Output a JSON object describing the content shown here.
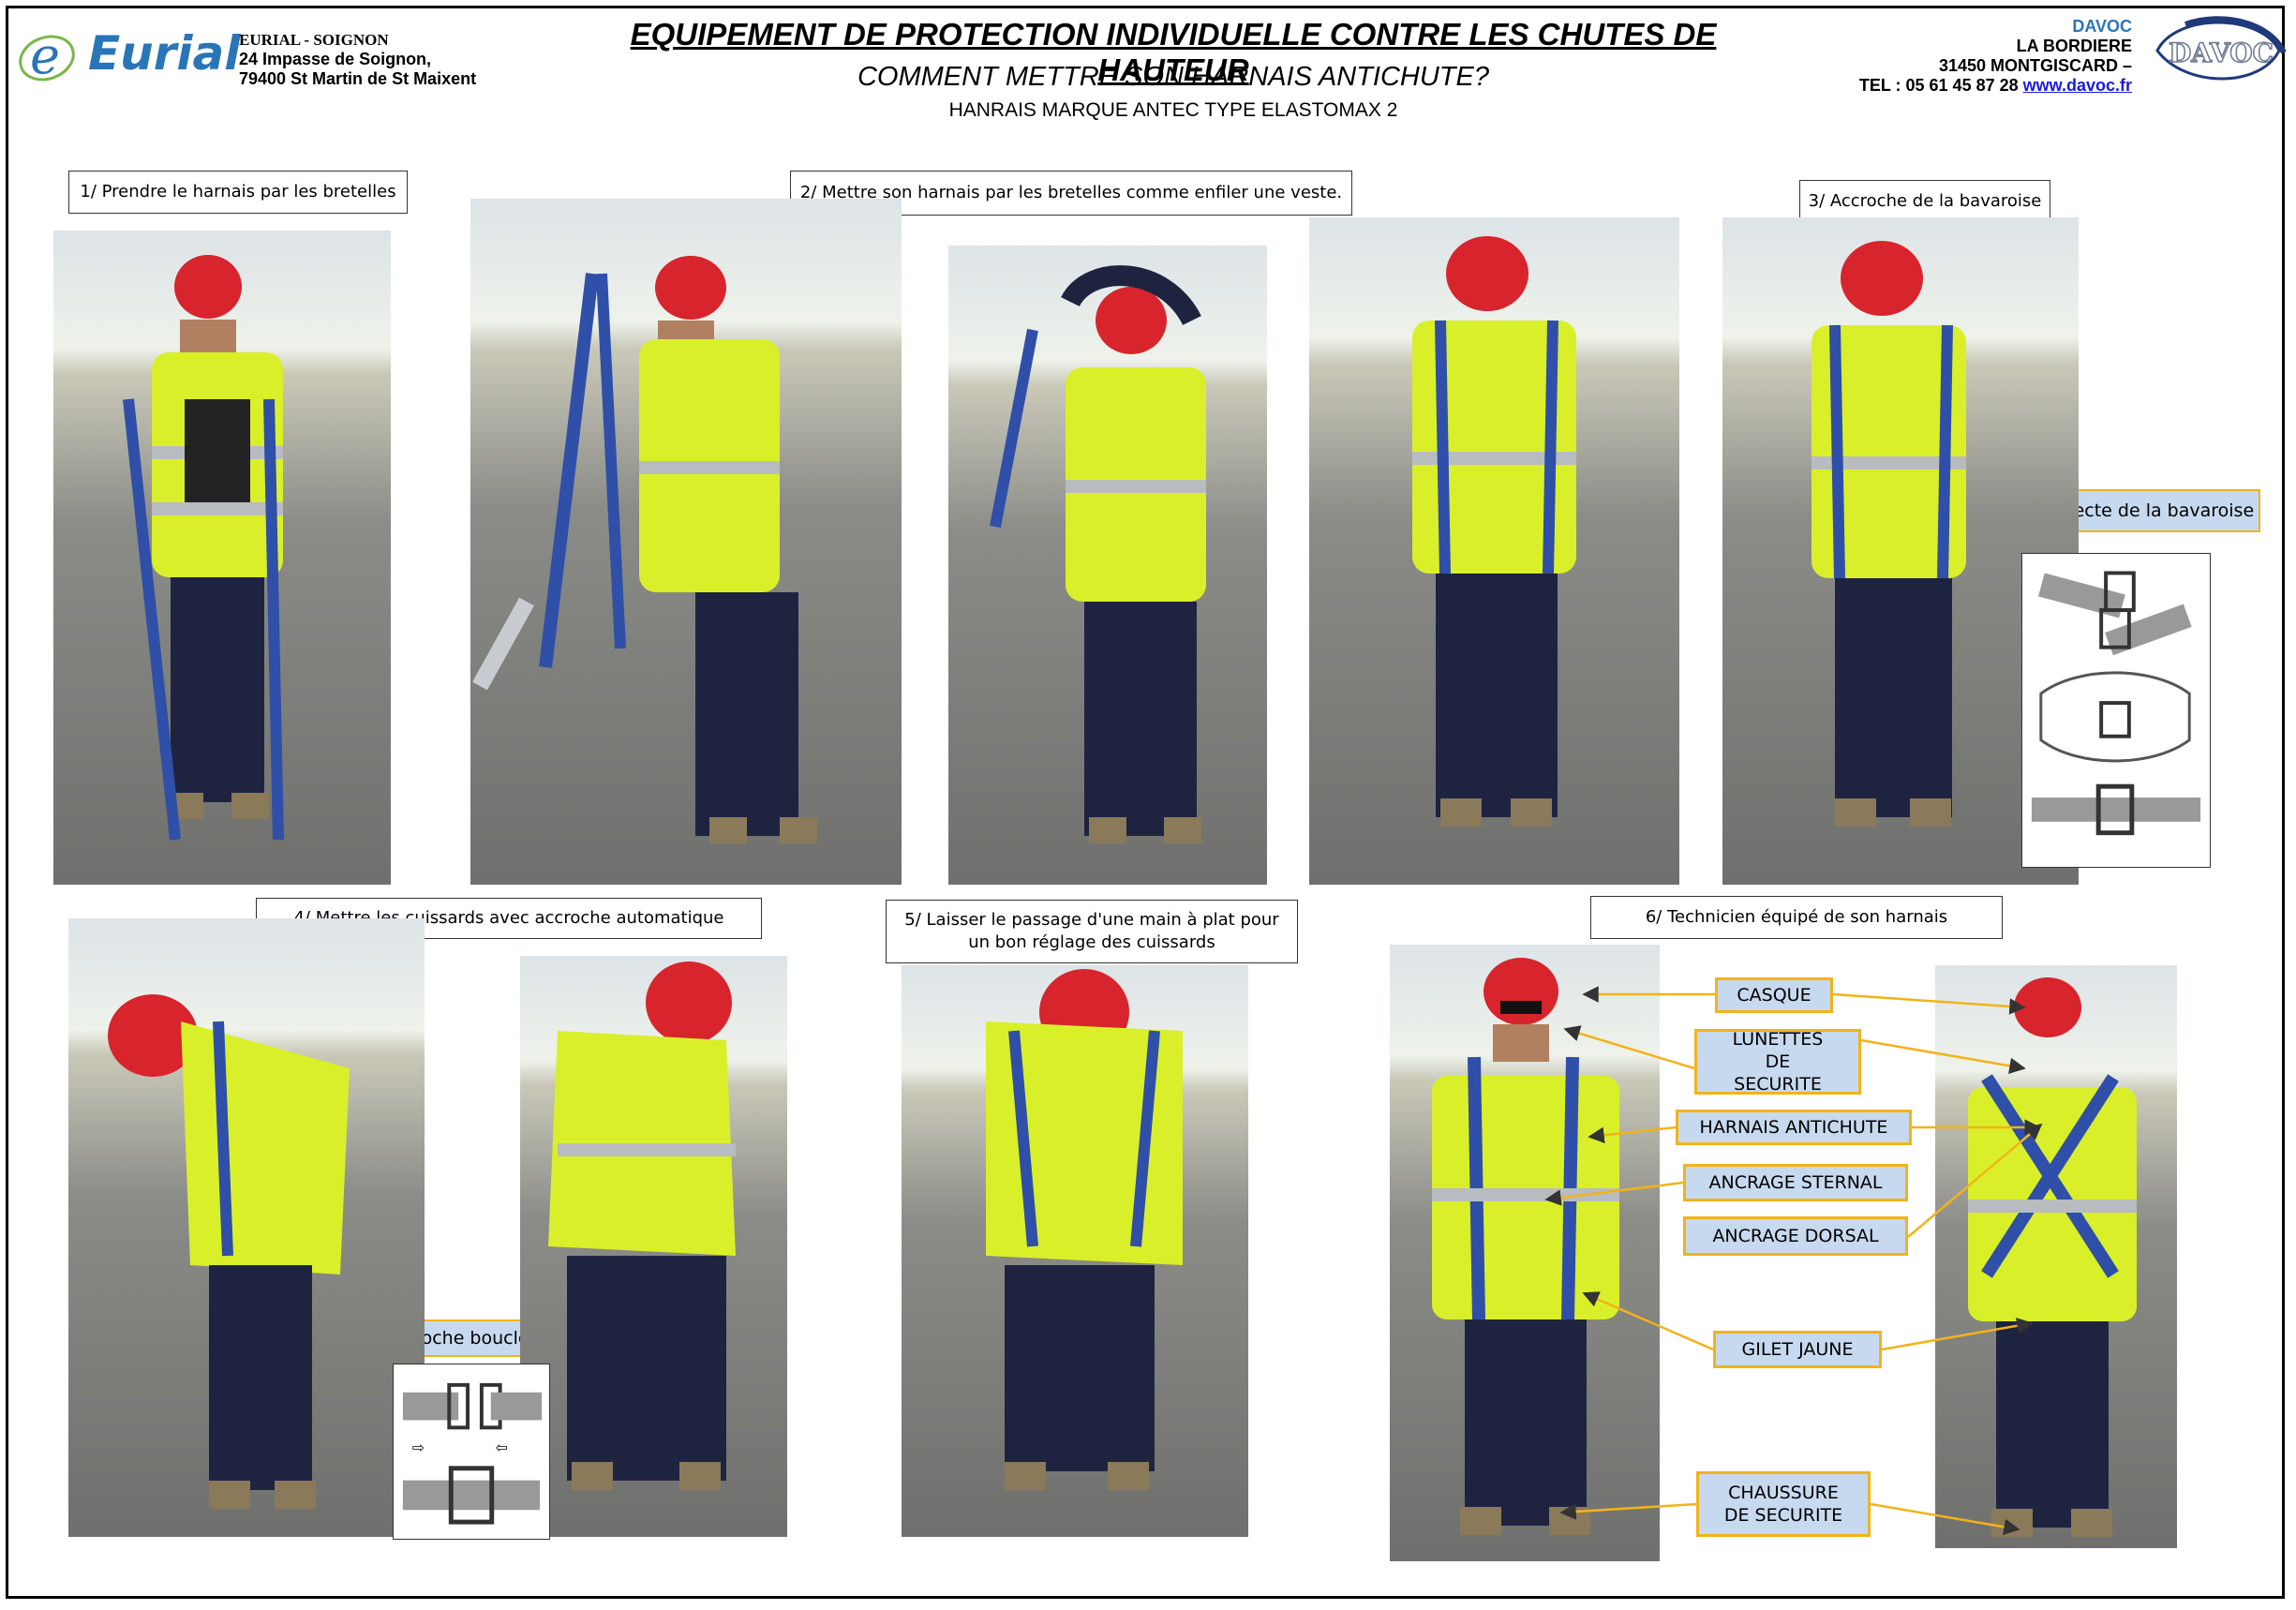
{
  "company": {
    "logo_text": "Eurial",
    "name": "EURIAL - SOIGNON",
    "address1": "24 Impasse de Soignon,",
    "address2": "79400 St Martin de St Maixent"
  },
  "titles": {
    "main": "EQUIPEMENT DE PROTECTION INDIVIDUELLE CONTRE LES CHUTES DE HAUTEUR",
    "sub": "COMMENT METTRE SON HARNAIS ANTICHUTE?",
    "model": "HANRAIS MARQUE ANTEC TYPE ELASTOMAX 2"
  },
  "supplier": {
    "name": "DAVOC",
    "line1": "LA BORDIERE",
    "line2": "31450 MONTGISCARD –",
    "tel": "TEL : 05 61 45 87 28",
    "website": "www.davoc.fr",
    "logo_text": "DAVOC"
  },
  "steps": {
    "s1": "1/ Prendre le harnais par les bretelles",
    "s2": "2/ Mettre son harnais par les bretelles comme enfiler une veste.",
    "s3": "3/ Accroche de la bavaroise",
    "s3_note": "Accroche correcte de la bavaroise",
    "s4": "4/ Mettre les cuissards avec accroche automatique",
    "s4_note": "Accroche boucle auto",
    "s5": "5/ Laisser le passage d'une main à plat pour un bon réglage des cuissards",
    "s6": "6/ Technicien équipé de son harnais"
  },
  "equipment_labels": {
    "casque": "CASQUE",
    "lunettes": "LUNETTES DE SECURITE",
    "harnais": "HARNAIS ANTICHUTE",
    "sternal": "ANCRAGE STERNAL",
    "dorsal": "ANCRAGE DORSAL",
    "gilet": "GILET JAUNE",
    "chaussure": "CHAUSSURE DE SECURITE"
  },
  "colors": {
    "helmet": "#d8242c",
    "vest": "#d9ef2a",
    "harness": "#2f4fa8",
    "callout_border": "#f2b31a",
    "callout_fill": "#c7d9ef",
    "brand_blue": "#2a74b8"
  }
}
